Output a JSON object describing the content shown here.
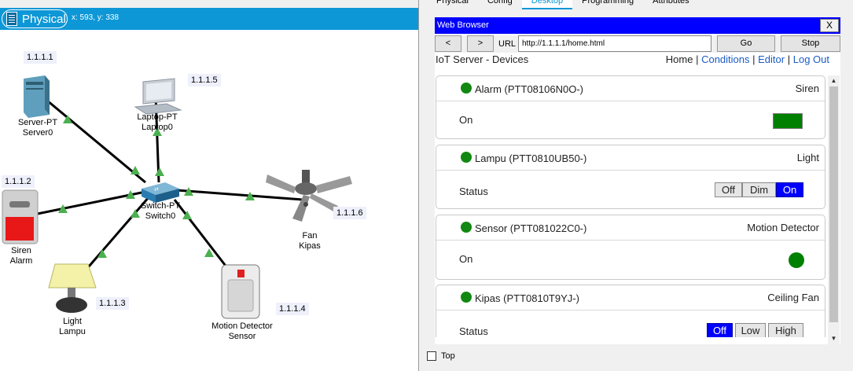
{
  "workspace": {
    "mode_label": "Physical",
    "coords": "x: 593, y: 338",
    "devices": [
      {
        "id": "server",
        "label1": "Server-PT",
        "label2": "Server0",
        "ip": "1.1.1.1"
      },
      {
        "id": "laptop",
        "label1": "Laptop-PT",
        "label2": "Laptop0",
        "ip": "1.1.1.5"
      },
      {
        "id": "switch",
        "label1": "Switch-PT",
        "label2": "Switch0",
        "ip": ""
      },
      {
        "id": "siren",
        "label1": "Siren",
        "label2": "Alarm",
        "ip": "1.1.1.2"
      },
      {
        "id": "fan",
        "label1": "Fan",
        "label2": "Kipas",
        "ip": "1.1.1.6"
      },
      {
        "id": "light",
        "label1": "Light",
        "label2": "Lampu",
        "ip": "1.1.1.3"
      },
      {
        "id": "sensor",
        "label1": "Motion Detector",
        "label2": "Sensor",
        "ip": "1.1.1.4"
      }
    ]
  },
  "panel": {
    "tabs": [
      "Physical",
      "Config",
      "Desktop",
      "Programming",
      "Attributes"
    ],
    "active_tab": "Desktop",
    "browser": {
      "title": "Web Browser",
      "close_label": "X",
      "back_label": "<",
      "forward_label": ">",
      "url_label": "URL",
      "url_value": "http://1.1.1.1/home.html",
      "go_label": "Go",
      "stop_label": "Stop"
    },
    "page": {
      "heading": "IoT Server - Devices",
      "links": {
        "home": "Home",
        "conditions": "Conditions",
        "editor": "Editor",
        "logout": "Log Out"
      },
      "devices": [
        {
          "name": "Alarm (PTT08106N0O-)",
          "type": "Siren",
          "prop": "On",
          "control": "indicator-rect",
          "indicator_color": "#008000"
        },
        {
          "name": "Lampu (PTT0810UB50-)",
          "type": "Light",
          "prop": "Status",
          "control": "buttons",
          "options": [
            "Off",
            "Dim",
            "On"
          ],
          "selected": "On"
        },
        {
          "name": "Sensor (PTT081022C0-)",
          "type": "Motion Detector",
          "prop": "On",
          "control": "indicator-dot",
          "indicator_color": "#008000"
        },
        {
          "name": "Kipas (PTT0810T9YJ-)",
          "type": "Ceiling Fan",
          "prop": "Status",
          "control": "buttons",
          "options": [
            "Off",
            "Low",
            "High"
          ],
          "selected": "Off"
        }
      ]
    },
    "top_checkbox_label": "Top",
    "top_checked": false
  },
  "colors": {
    "accent": "#0d97d6",
    "browser_title": "#0000ff",
    "status_green": "#118811",
    "link": "#1a5bc4"
  }
}
